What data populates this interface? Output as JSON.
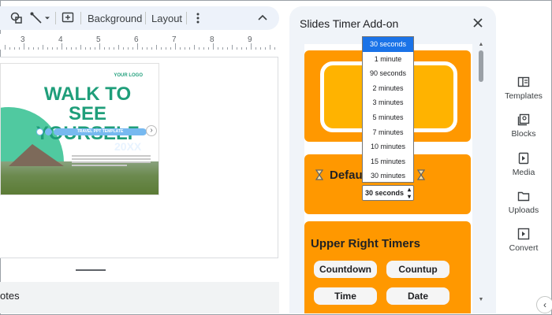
{
  "toolbar": {
    "background_label": "Background",
    "layout_label": "Layout"
  },
  "ruler": {
    "numbers": [
      "3",
      "4",
      "5",
      "6",
      "7",
      "8",
      "9"
    ]
  },
  "slide": {
    "logo": "YOUR LOGO",
    "title_line1": "WALK TO SEE",
    "title_line2": "YOURSELF",
    "subtitle": "TRAVEL PPT TEMPLATE",
    "year": "20XX"
  },
  "notes": {
    "label": "otes"
  },
  "panel": {
    "title": "Slides Timer Add-on",
    "default_card_label": "Defau",
    "upper_right_heading": "Upper Right Timers",
    "buttons": {
      "countdown": "Countdown",
      "countup": "Countup",
      "time": "Time",
      "date": "Date"
    }
  },
  "dropdown": {
    "options": [
      "30 seconds",
      "1 minute",
      "90 seconds",
      "2 minutes",
      "3 minutes",
      "5 minutes",
      "7 minutes",
      "10 minutes",
      "15 minutes",
      "30 minutes"
    ],
    "selected_value": "30 seconds"
  },
  "rail": {
    "items": [
      {
        "label": "Templates",
        "icon": "templates-icon"
      },
      {
        "label": "Blocks",
        "icon": "blocks-icon"
      },
      {
        "label": "Media",
        "icon": "media-icon"
      },
      {
        "label": "Uploads",
        "icon": "uploads-icon"
      },
      {
        "label": "Convert",
        "icon": "convert-icon"
      }
    ]
  },
  "colors": {
    "card_orange": "#ff9800",
    "preview_amber": "#ffb300",
    "selected_blue": "#1a73e8",
    "slide_green": "#1f9e7a"
  }
}
